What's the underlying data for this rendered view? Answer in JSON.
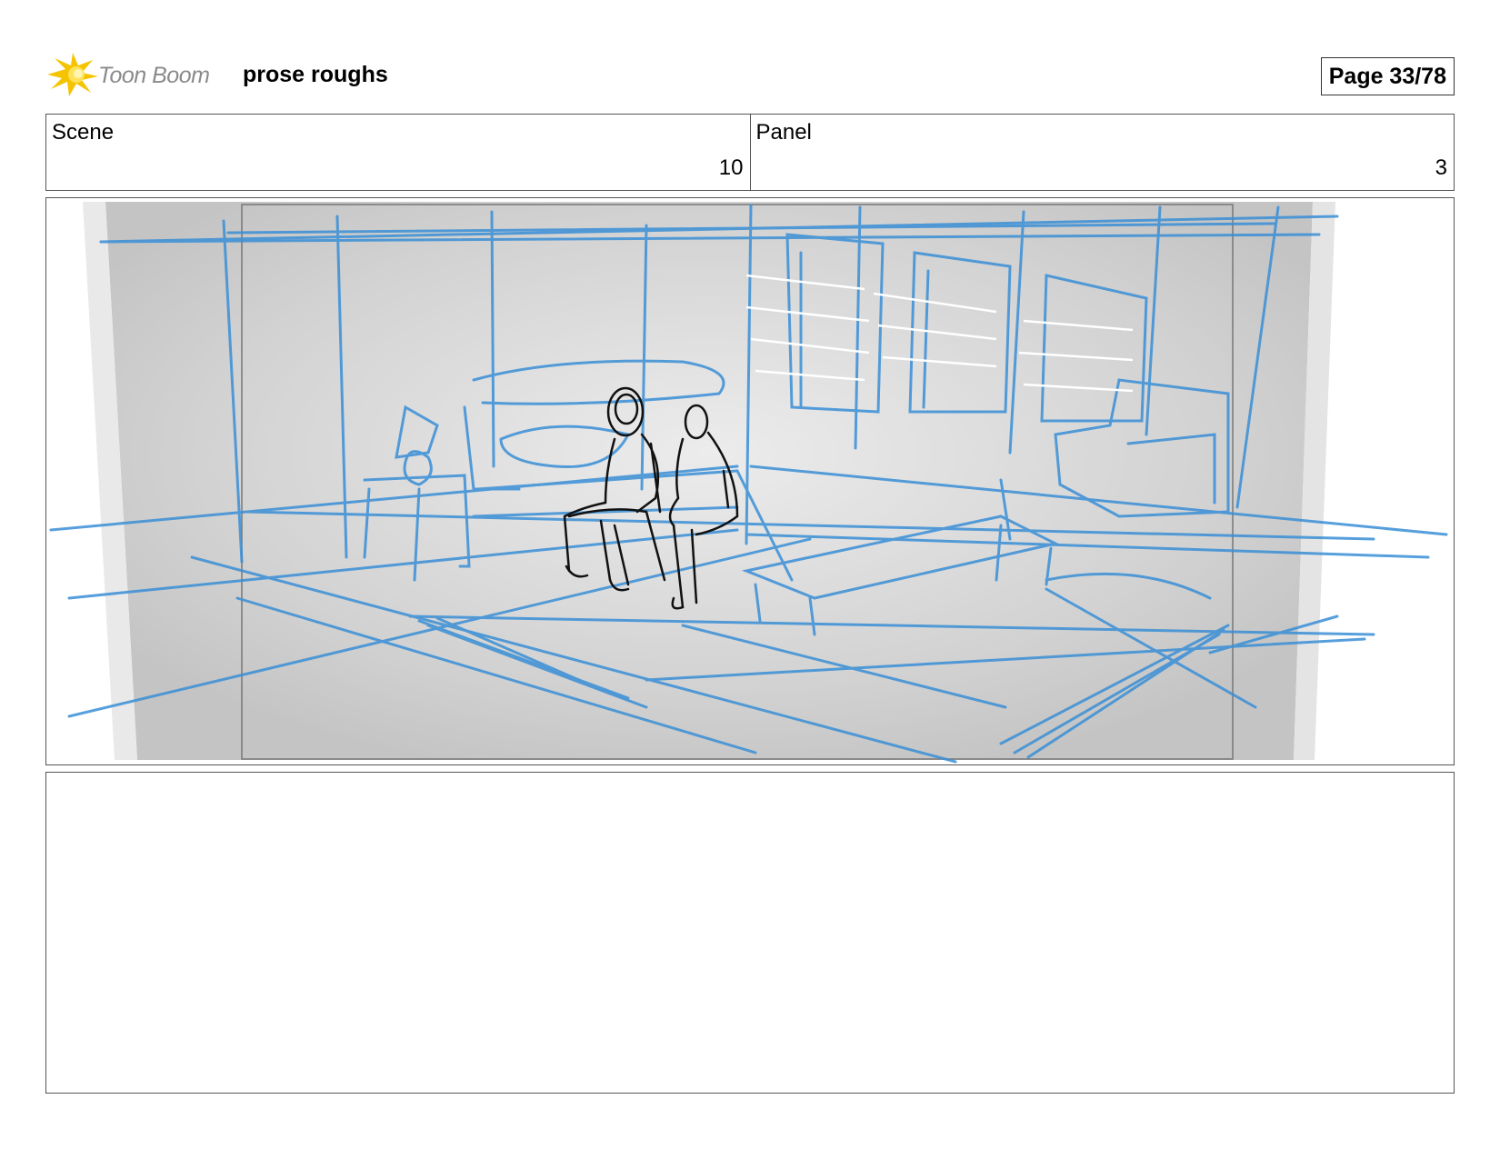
{
  "header": {
    "logo_text": "Toon Boom",
    "project_title": "prose roughs",
    "page_label": "Page 33/78"
  },
  "scene": {
    "label": "Scene",
    "value": "10"
  },
  "panel": {
    "label": "Panel",
    "value": "3"
  },
  "drawing": {
    "description_icon": "storyboard-sketch",
    "sketch_color": "#3a8fd6",
    "figure_color": "#111111",
    "background_color": "#d6d6d6"
  },
  "notes": {
    "text": ""
  }
}
